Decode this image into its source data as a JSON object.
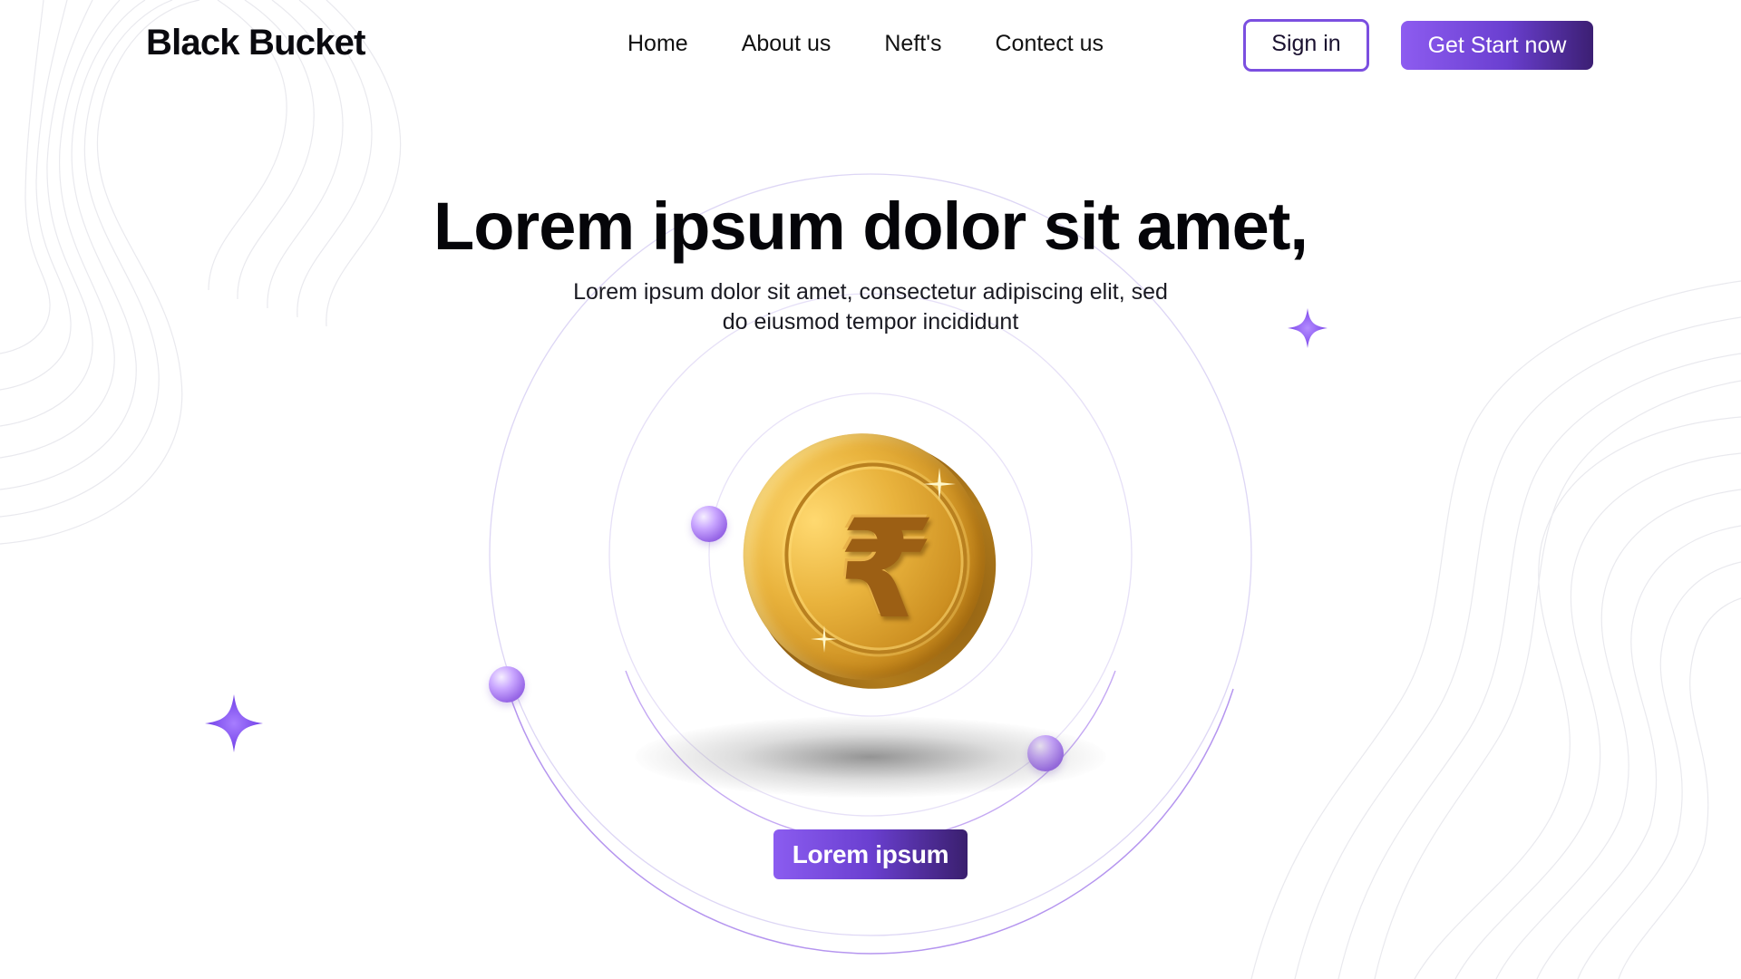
{
  "brand": {
    "logo_text": "Black Bucket"
  },
  "nav": {
    "items": [
      {
        "label": "Home"
      },
      {
        "label": "About us"
      },
      {
        "label": "Neft's"
      },
      {
        "label": "Contect us"
      }
    ],
    "signin_label": "Sign in",
    "cta_label": "Get Start now"
  },
  "hero": {
    "title": "Lorem ipsum dolor sit amet,",
    "subtitle_line1": "Lorem ipsum dolor sit amet, consectetur adipiscing elit, sed",
    "subtitle_line2": "do eiusmod tempor incididunt",
    "coin_symbol": "₹",
    "button_label": "Lorem ipsum"
  },
  "icons": {
    "coin": "rupee-coin-icon",
    "sparkle": "sparkle-star-icon",
    "orb": "purple-orb-icon"
  },
  "colors": {
    "accent": "#7b4fe0",
    "accent_dark": "#3c1f73",
    "coin_gold": "#e9b33d",
    "star_purple": "#8a55f0",
    "orbit_line": "#b89cf2"
  }
}
